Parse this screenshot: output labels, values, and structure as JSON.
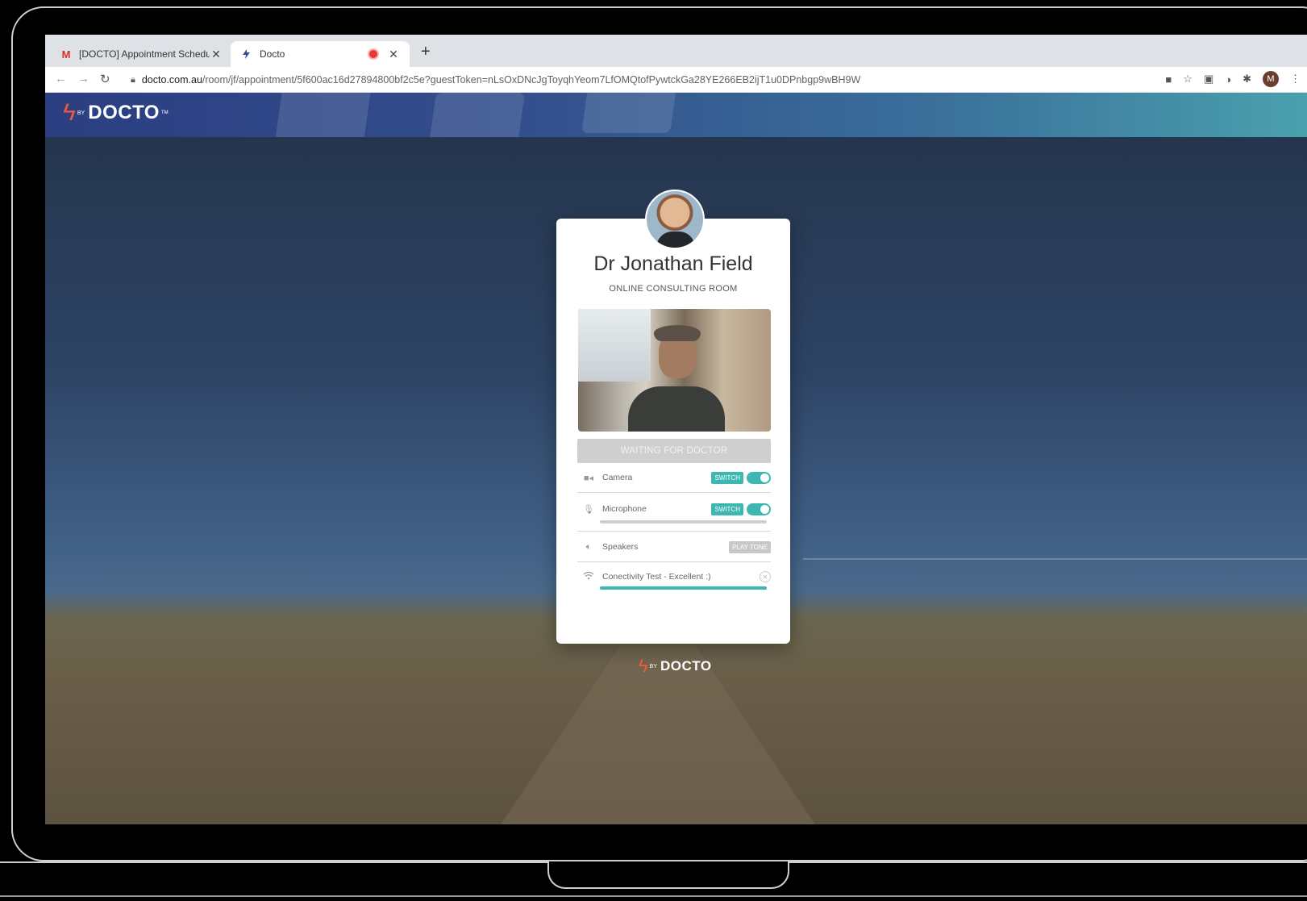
{
  "browser": {
    "tabs": [
      {
        "title": "[DOCTO] Appointment Schedu",
        "favicon": "M",
        "active": false
      },
      {
        "title": "Docto",
        "favicon": "docto-favicon",
        "active": true,
        "recording": true
      }
    ],
    "new_tab_label": "+",
    "url_host": "docto.com.au",
    "url_path": "/room/jf/appointment/5f600ac16d27894800bf2c5e?guestToken=nLsOxDNcJgToyqhYeom7LfOMQtofPywtckGa28YE266EB2ijT1u0DPnbgp9wBH9W",
    "profile_initial": "M"
  },
  "header": {
    "logo_by": "BY",
    "logo_word": "DOCTO",
    "logo_tm": "TM"
  },
  "card": {
    "doctor_name": "Dr Jonathan Field",
    "room_label": "ONLINE CONSULTING ROOM",
    "waiting_label": "WAITING FOR DOCTOR",
    "camera": {
      "label": "Camera",
      "button": "SWITCH",
      "enabled": true
    },
    "microphone": {
      "label": "Microphone",
      "button": "SWITCH",
      "enabled": true,
      "level": 0
    },
    "speakers": {
      "label": "Speakers",
      "button": "PLAY TONE"
    },
    "connectivity": {
      "label": "Conectivity Test - Excellent :)",
      "progress": 1.0
    }
  },
  "footer": {
    "logo_by": "BY",
    "logo_word": "DOCTO"
  },
  "colors": {
    "accent": "#3cb7b2",
    "header_start": "#2b3e82",
    "header_end": "#4aa0ad",
    "logo_bolt": "#f05a3a"
  }
}
